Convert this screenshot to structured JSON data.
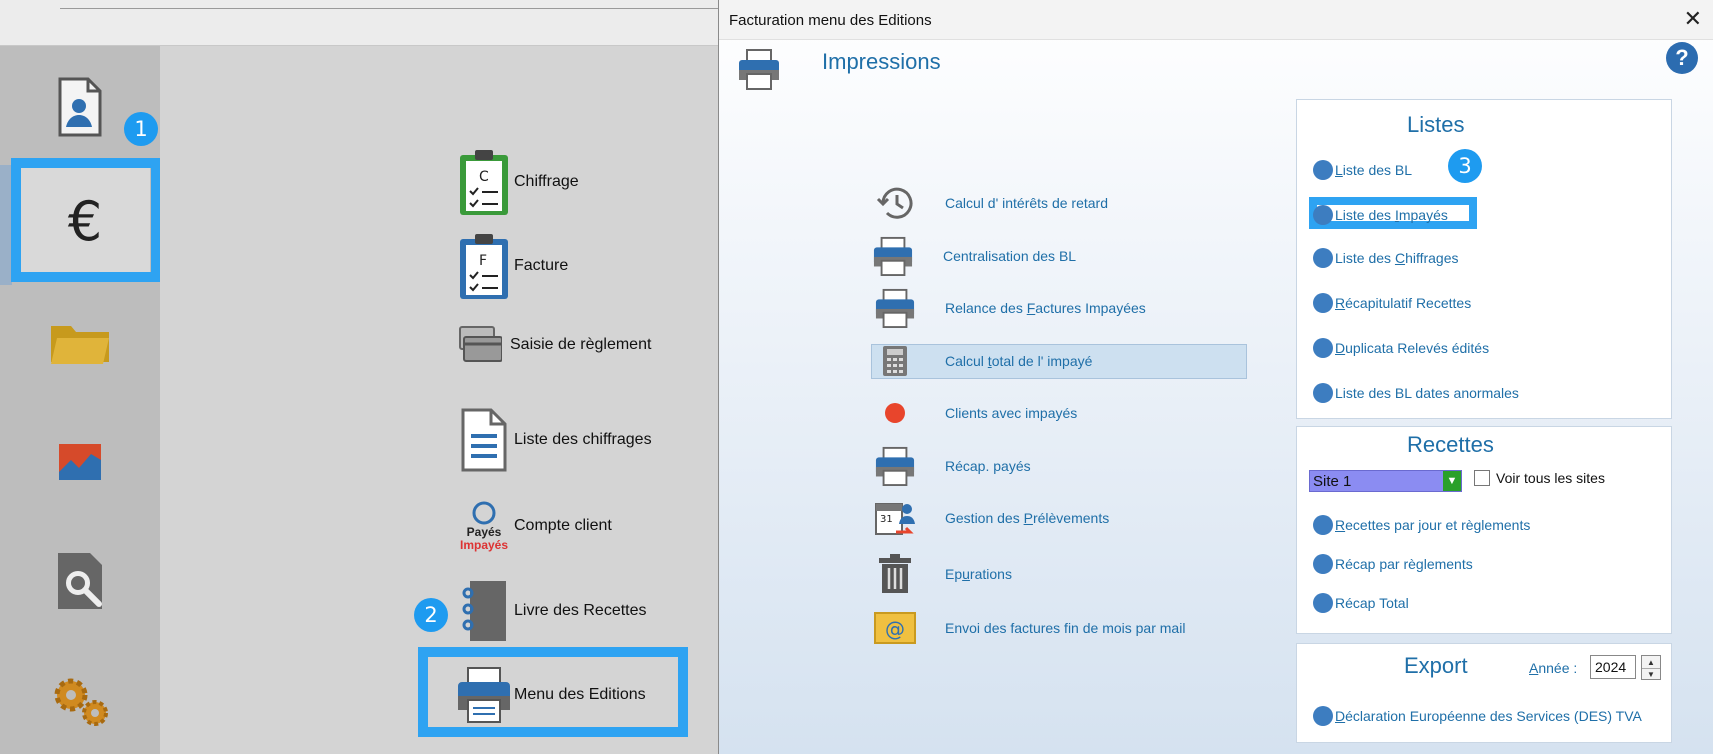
{
  "background": {
    "menu_items": [
      {
        "label": "Chiffrage",
        "icon": "clipboard-c-icon"
      },
      {
        "label": "Facture",
        "icon": "clipboard-f-icon"
      },
      {
        "label": "Saisie de règlement",
        "icon": "card-icon"
      },
      {
        "label": "Liste des chiffrages",
        "icon": "document-list-icon"
      },
      {
        "label": "Compte client",
        "icon": "payes-impayes-icon",
        "icon_text_1": "Payés",
        "icon_text_2": "Impayés"
      },
      {
        "label": "Livre des Recettes",
        "icon": "notebook-icon"
      },
      {
        "label": "Menu des Editions",
        "icon": "printer-icon"
      }
    ],
    "badges": [
      "1",
      "2"
    ],
    "rail_icons": [
      "user-card-icon",
      "euro-icon",
      "folder-icon",
      "chart-icon",
      "search-doc-icon",
      "gears-icon"
    ]
  },
  "dialog": {
    "title": "Facturation menu des Editions",
    "close": "✕",
    "help": "?",
    "impressions_title": "Impressions",
    "impressions": [
      {
        "label": "Calcul d' intérêts de retard",
        "icon": "history-icon"
      },
      {
        "label": "Centralisation des BL",
        "icon": "printer-icon"
      },
      {
        "label_pre": "Relance des ",
        "label_u": "F",
        "label_post": "actures Impayées",
        "icon": "printer-icon"
      },
      {
        "label_pre": "Calcul ",
        "label_u": "t",
        "label_post": "otal de l' impayé",
        "icon": "calculator-icon",
        "selected": true
      },
      {
        "label": "Clients avec  impayés",
        "icon": "red-dot-icon"
      },
      {
        "label": "Récap. payés",
        "icon": "printer-icon"
      },
      {
        "label_pre": "Gestion des ",
        "label_u": "P",
        "label_post": "rélèvements",
        "icon": "calendar-icon"
      },
      {
        "label_pre": "Ep",
        "label_u": "u",
        "label_post": "rations",
        "icon": "trash-icon"
      },
      {
        "label": "Envoi des factures fin de mois par mail",
        "icon": "mail-icon"
      }
    ],
    "listes": {
      "title": "Listes",
      "badge": "3",
      "items": [
        {
          "label_pre": "",
          "label_u": "L",
          "label_post": "iste des BL"
        },
        {
          "label_pre": "Liste des ",
          "label_u": "I",
          "label_post": "mpayés"
        },
        {
          "label_pre": "Liste des ",
          "label_u": "C",
          "label_post": "hiffrages"
        },
        {
          "label_pre": "",
          "label_u": "R",
          "label_post": "écapitulatif Recettes"
        },
        {
          "label_pre": "",
          "label_u": "D",
          "label_post": "uplicata Relevés édités"
        },
        {
          "label_pre": "Liste des BL dates anormales",
          "label_u": "",
          "label_post": ""
        }
      ]
    },
    "recettes": {
      "title": "Recettes",
      "site_value": "Site 1",
      "checkbox_label": "Voir tous les sites",
      "items": [
        {
          "label_pre": "",
          "label_u": "R",
          "label_post": "ecettes par jour et règlements"
        },
        {
          "label_pre": "Récap par règlements",
          "label_u": "",
          "label_post": ""
        },
        {
          "label_pre": "Récap Total",
          "label_u": "",
          "label_post": ""
        }
      ]
    },
    "export": {
      "title": "Export",
      "annee_label_u": "A",
      "annee_label_post": "nnée :",
      "annee_value": "2024",
      "items": [
        {
          "label_pre": "",
          "label_u": "D",
          "label_post": "éclaration Européenne des Services (DES) TVA"
        }
      ]
    }
  },
  "colors": {
    "accent": "#2ea3f2",
    "link": "#1f6fa8",
    "radio": "#3d7dc0"
  }
}
